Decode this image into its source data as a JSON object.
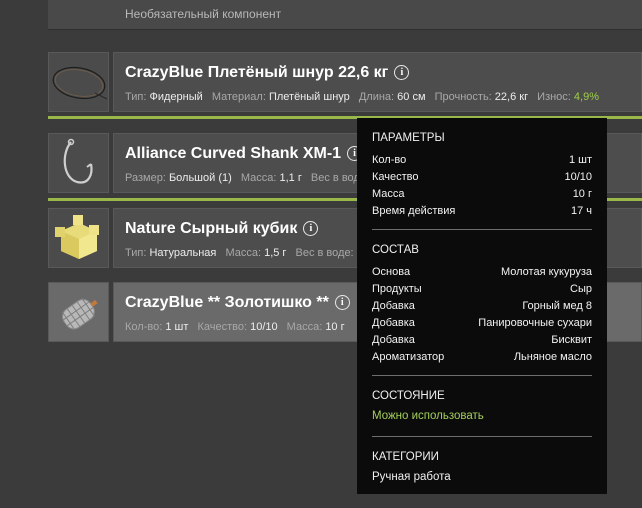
{
  "top_row": {
    "label": "Необязательный компонент"
  },
  "rows": [
    {
      "title": "CrazyBlue Плетёный шнур 22,6 кг",
      "props": [
        {
          "k": "Тип:",
          "v": "Фидерный"
        },
        {
          "k": "Материал:",
          "v": "Плетёный шнур"
        },
        {
          "k": "Длина:",
          "v": "60 см"
        },
        {
          "k": "Прочность:",
          "v": "22,6 кг"
        },
        {
          "k": "Износ:",
          "v": "4,9%"
        }
      ]
    },
    {
      "title": "Alliance Curved Shank XM-1",
      "props": [
        {
          "k": "Размер:",
          "v": "Большой (1)"
        },
        {
          "k": "Масса:",
          "v": "1,1 г"
        },
        {
          "k": "Вес в воде:",
          "v": ""
        }
      ]
    },
    {
      "title": "Nature Сырный кубик",
      "props": [
        {
          "k": "Тип:",
          "v": "Натуральная"
        },
        {
          "k": "Масса:",
          "v": "1,5 г"
        },
        {
          "k": "Вес в воде:",
          "v": ""
        }
      ]
    },
    {
      "title": "CrazyBlue ** Золотишко **",
      "props": [
        {
          "k": "Кол-во:",
          "v": "1 шт"
        },
        {
          "k": "Качество:",
          "v": "10/10"
        },
        {
          "k": "Масса:",
          "v": "10 г"
        }
      ]
    }
  ],
  "info_icon_glyph": "i",
  "tooltip": {
    "params_title": "ПАРАМЕТРЫ",
    "params": [
      {
        "k": "Кол-во",
        "v": "1 шт"
      },
      {
        "k": "Качество",
        "v": "10/10"
      },
      {
        "k": "Масса",
        "v": "10 г"
      },
      {
        "k": "Время действия",
        "v": "17 ч"
      }
    ],
    "composition_title": "СОСТАВ",
    "composition": [
      {
        "k": "Основа",
        "v": "Молотая кукуруза"
      },
      {
        "k": "Продукты",
        "v": "Сыр"
      },
      {
        "k": "Добавка",
        "v": "Горный мед 8"
      },
      {
        "k": "Добавка",
        "v": "Панировочные сухари"
      },
      {
        "k": "Добавка",
        "v": "Бисквит"
      },
      {
        "k": "Ароматизатор",
        "v": "Льняное масло"
      }
    ],
    "state_title": "СОСТОЯНИЕ",
    "state_value": "Можно использовать",
    "categories_title": "КАТЕГОРИИ",
    "categories_value": "Ручная работа"
  },
  "colors": {
    "accent": "#9ab84a",
    "state_green": "#a3cf5c",
    "wear_green": "#9bcf45"
  },
  "icons": [
    "fishing-line-icon",
    "hook-icon",
    "cheese-cube-icon",
    "feeder-cage-icon",
    "info-icon"
  ]
}
